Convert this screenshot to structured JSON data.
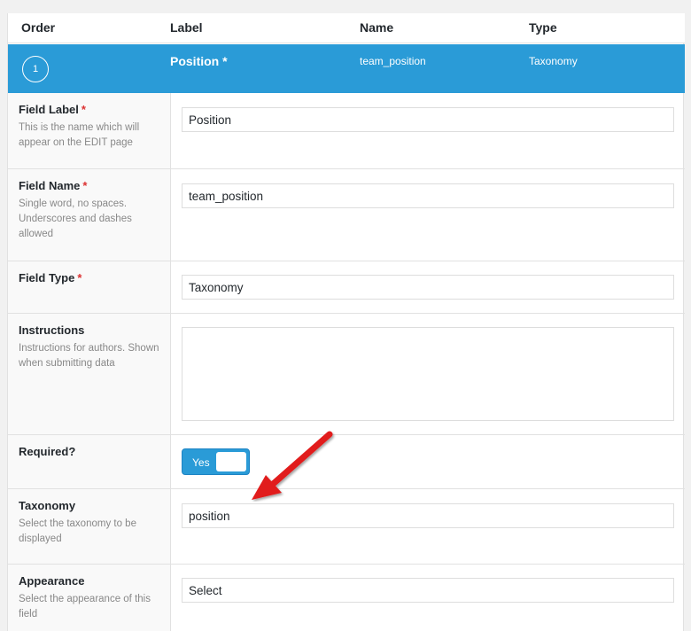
{
  "header": {
    "order": "Order",
    "label": "Label",
    "name": "Name",
    "type": "Type"
  },
  "field_bar": {
    "order_number": "1",
    "label": "Position *",
    "name": "team_position",
    "type": "Taxonomy"
  },
  "rows": {
    "field_label": {
      "title": "Field Label",
      "required_mark": "*",
      "description": "This is the name which will appear on the EDIT page",
      "value": "Position"
    },
    "field_name": {
      "title": "Field Name",
      "required_mark": "*",
      "description": "Single word, no spaces. Underscores and dashes allowed",
      "value": "team_position"
    },
    "field_type": {
      "title": "Field Type",
      "required_mark": "*",
      "value": "Taxonomy"
    },
    "instructions": {
      "title": "Instructions",
      "description": "Instructions for authors. Shown when submitting data",
      "value": ""
    },
    "required": {
      "title": "Required?",
      "toggle_label": "Yes",
      "toggle_on": true
    },
    "taxonomy": {
      "title": "Taxonomy",
      "description": "Select the taxonomy to be displayed",
      "value": "position"
    },
    "appearance": {
      "title": "Appearance",
      "description": "Select the appearance of this field",
      "value": "Select"
    }
  },
  "colors": {
    "accent": "#2a9bd7",
    "required_mark": "#dc3232",
    "annotation_arrow": "#e11b1b"
  },
  "annotation": {
    "icon": "red-arrow-icon",
    "points_to": "taxonomy-input"
  }
}
